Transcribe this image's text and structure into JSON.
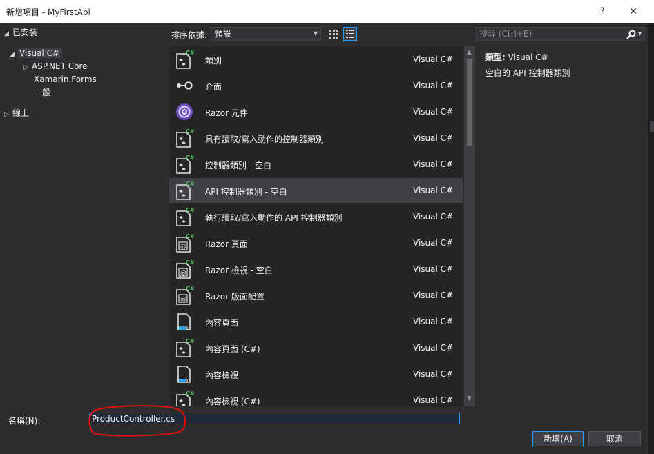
{
  "window": {
    "title": "新增項目 - MyFirstApi",
    "help_glyph": "?",
    "close_glyph": "✕"
  },
  "tree": {
    "installed": "已安裝",
    "visual_csharp": "Visual C#",
    "aspnet_core": "ASP.NET Core",
    "xamarin_forms": "Xamarin.Forms",
    "general": "一般",
    "online": "線上"
  },
  "toolbar": {
    "sort_label": "排序依據:",
    "sort_value": "預設"
  },
  "search": {
    "placeholder": "搜尋 (Ctrl+E)"
  },
  "templates": [
    {
      "name": "類別",
      "lang": "Visual C#",
      "icon": "csharp-class-icon"
    },
    {
      "name": "介面",
      "lang": "Visual C#",
      "icon": "interface-icon"
    },
    {
      "name": "Razor 元件",
      "lang": "Visual C#",
      "icon": "razor-component-icon"
    },
    {
      "name": "具有讀取/寫入動作的控制器類別",
      "lang": "Visual C#",
      "icon": "csharp-class-icon"
    },
    {
      "name": "控制器類別 - 空白",
      "lang": "Visual C#",
      "icon": "csharp-class-icon"
    },
    {
      "name": "API 控制器類別 - 空白",
      "lang": "Visual C#",
      "icon": "csharp-class-icon",
      "selected": true
    },
    {
      "name": "執行讀取/寫入動作的 API 控制器類別",
      "lang": "Visual C#",
      "icon": "csharp-class-icon"
    },
    {
      "name": "Razor 頁面",
      "lang": "Visual C#",
      "icon": "razor-page-icon"
    },
    {
      "name": "Razor 檢視 - 空白",
      "lang": "Visual C#",
      "icon": "razor-page-icon"
    },
    {
      "name": "Razor 版面配置",
      "lang": "Visual C#",
      "icon": "razor-page-icon"
    },
    {
      "name": "內容頁面",
      "lang": "Visual C#",
      "icon": "content-page-icon"
    },
    {
      "name": "內容頁面 (C#)",
      "lang": "Visual C#",
      "icon": "csharp-class-icon"
    },
    {
      "name": "內容檢視",
      "lang": "Visual C#",
      "icon": "content-page-icon"
    },
    {
      "name": "內容檢視 (C#)",
      "lang": "Visual C#",
      "icon": "csharp-class-icon"
    }
  ],
  "detail": {
    "type_label": "類型:",
    "type_value": "Visual C#",
    "description": "空白的 API 控制器類別"
  },
  "name_field": {
    "label": "名稱(N):",
    "value": "ProductController.cs"
  },
  "buttons": {
    "add": "新增(A)",
    "cancel": "取消"
  },
  "colors": {
    "background": "#2d2d30",
    "list_background": "#252526",
    "selection": "#3f3f46",
    "accent": "#3399ff",
    "annotation": "#e01010"
  }
}
